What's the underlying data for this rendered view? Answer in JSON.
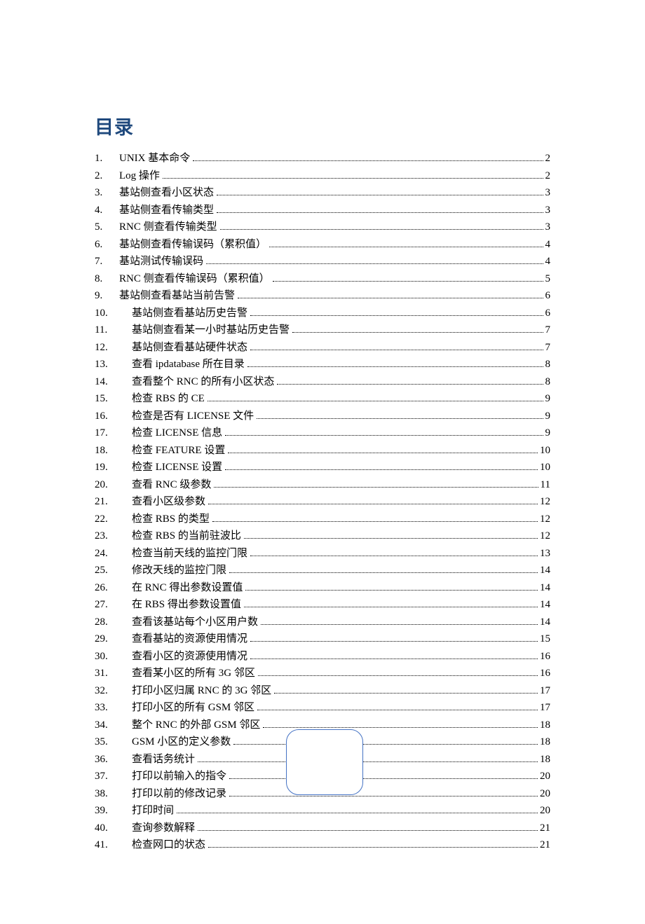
{
  "title": "目录",
  "entries": [
    {
      "num": "1.",
      "indent": false,
      "title": "UNIX 基本命令",
      "page": "2"
    },
    {
      "num": "2.",
      "indent": false,
      "title": "Log 操作",
      "page": "2"
    },
    {
      "num": "3.",
      "indent": false,
      "title": "基站侧查看小区状态",
      "page": "3"
    },
    {
      "num": "4.",
      "indent": false,
      "title": "基站侧查看传输类型",
      "page": "3"
    },
    {
      "num": "5.",
      "indent": false,
      "title": "RNC 侧查看传输类型",
      "page": "3"
    },
    {
      "num": "6.",
      "indent": false,
      "title": "基站侧查看传输误码（累积值）",
      "page": "4"
    },
    {
      "num": "7.",
      "indent": false,
      "title": "基站测试传输误码",
      "page": "4"
    },
    {
      "num": "8.",
      "indent": false,
      "title": "RNC 侧查看传输误码（累积值）",
      "page": "5"
    },
    {
      "num": "9.",
      "indent": false,
      "title": "基站侧查看基站当前告警",
      "page": "6"
    },
    {
      "num": "10.",
      "indent": true,
      "title": "基站侧查看基站历史告警",
      "page": "6"
    },
    {
      "num": "11.",
      "indent": true,
      "title": "基站侧查看某一小时基站历史告警",
      "page": "7"
    },
    {
      "num": "12.",
      "indent": true,
      "title": "基站侧查看基站硬件状态",
      "page": "7"
    },
    {
      "num": "13.",
      "indent": true,
      "title": "查看 ipdatabase 所在目录",
      "page": "8"
    },
    {
      "num": "14.",
      "indent": true,
      "title": "查看整个 RNC 的所有小区状态",
      "page": "8"
    },
    {
      "num": "15.",
      "indent": true,
      "title": "检查 RBS 的 CE",
      "page": "9"
    },
    {
      "num": "16.",
      "indent": true,
      "title": "检查是否有 LICENSE 文件",
      "page": "9"
    },
    {
      "num": "17.",
      "indent": true,
      "title": "检查 LICENSE 信息",
      "page": "9"
    },
    {
      "num": "18.",
      "indent": true,
      "title": "检查 FEATURE 设置",
      "page": "10"
    },
    {
      "num": "19.",
      "indent": true,
      "title": "检查 LICENSE 设置",
      "page": "10"
    },
    {
      "num": "20.",
      "indent": true,
      "title": "查看 RNC 级参数",
      "page": "11"
    },
    {
      "num": "21.",
      "indent": true,
      "title": "查看小区级参数",
      "page": "12"
    },
    {
      "num": "22.",
      "indent": true,
      "title": "检查 RBS 的类型",
      "page": "12"
    },
    {
      "num": "23.",
      "indent": true,
      "title": "检查 RBS 的当前驻波比",
      "page": "12"
    },
    {
      "num": "24.",
      "indent": true,
      "title": "检查当前天线的监控门限",
      "page": "13"
    },
    {
      "num": "25.",
      "indent": true,
      "title": "修改天线的监控门限",
      "page": "14"
    },
    {
      "num": "26.",
      "indent": true,
      "title": "在 RNC 得出参数设置值",
      "page": "14"
    },
    {
      "num": "27.",
      "indent": true,
      "title": "在 RBS 得出参数设置值",
      "page": "14"
    },
    {
      "num": "28.",
      "indent": true,
      "title": "查看该基站每个小区用户数",
      "page": "14"
    },
    {
      "num": "29.",
      "indent": true,
      "title": "查看基站的资源使用情况",
      "page": "15"
    },
    {
      "num": "30.",
      "indent": true,
      "title": "查看小区的资源使用情况",
      "page": "16"
    },
    {
      "num": "31.",
      "indent": true,
      "title": "查看某小区的所有 3G 邻区",
      "page": "16"
    },
    {
      "num": "32.",
      "indent": true,
      "title": "打印小区归属 RNC 的 3G 邻区",
      "page": "17"
    },
    {
      "num": "33.",
      "indent": true,
      "title": "打印小区的所有 GSM 邻区",
      "page": "17"
    },
    {
      "num": "34.",
      "indent": true,
      "title": "整个 RNC 的外部 GSM 邻区",
      "page": "18"
    },
    {
      "num": "35.",
      "indent": true,
      "title": "GSM 小区的定义参数",
      "page": "18"
    },
    {
      "num": "36.",
      "indent": true,
      "title": "查看话务统计",
      "page": "18"
    },
    {
      "num": "37.",
      "indent": true,
      "title": "打印以前输入的指令",
      "page": "20"
    },
    {
      "num": "38.",
      "indent": true,
      "title": "打印以前的修改记录",
      "page": "20"
    },
    {
      "num": "39.",
      "indent": true,
      "title": "打印时间",
      "page": "20"
    },
    {
      "num": "40.",
      "indent": true,
      "title": "查询参数解释",
      "page": "21"
    },
    {
      "num": "41.",
      "indent": true,
      "title": "检查网口的状态",
      "page": "21"
    }
  ]
}
